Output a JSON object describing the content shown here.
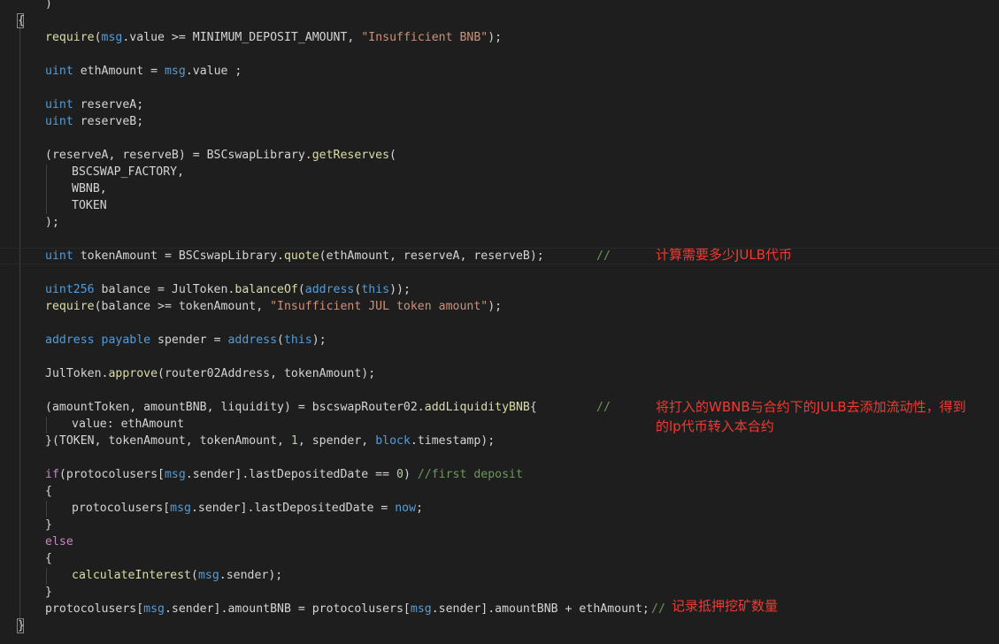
{
  "code": {
    "l01": ")",
    "l02": "{",
    "l03a": "require",
    "l03b": "(",
    "l03c": "msg",
    "l03d": ".value >= MINIMUM_DEPOSIT_AMOUNT, ",
    "l03e": "\"Insufficient BNB\"",
    "l03f": ");",
    "l04a": "uint",
    "l04b": " ethAmount = ",
    "l04c": "msg",
    "l04d": ".value ;",
    "l05a": "uint",
    "l05b": " reserveA;",
    "l06a": "uint",
    "l06b": " reserveB;",
    "l07a": "(reserveA, reserveB) = BSCswapLibrary.",
    "l07b": "getReserves",
    "l07c": "(",
    "l08": "BSCSWAP_FACTORY,",
    "l09": "WBNB,",
    "l10": "TOKEN",
    "l11": ");",
    "l12a": "uint",
    "l12b": " tokenAmount = BSCswapLibrary.",
    "l12c": "quote",
    "l12d": "(ethAmount, reserveA, reserveB);",
    "l12e": "//",
    "l13a": "uint256",
    "l13b": " balance = JulToken.",
    "l13c": "balanceOf",
    "l13d": "(",
    "l13e": "address",
    "l13f": "(",
    "l13g": "this",
    "l13h": "));",
    "l14a": "require",
    "l14b": "(balance >= tokenAmount, ",
    "l14c": "\"Insufficient JUL token amount\"",
    "l14d": ");",
    "l15a": "address",
    "l15b": " ",
    "l15c": "payable",
    "l15d": " spender = ",
    "l15e": "address",
    "l15f": "(",
    "l15g": "this",
    "l15h": ");",
    "l16a": "JulToken.",
    "l16b": "approve",
    "l16c": "(router02Address, tokenAmount);",
    "l17a": "(amountToken, amountBNB, liquidity) = bscswapRouter02.",
    "l17b": "addLiquidityBNB",
    "l17c": "{",
    "l17d": "//",
    "l18": "value: ethAmount",
    "l19a": "}(TOKEN, tokenAmount, tokenAmount, ",
    "l19b": "1",
    "l19c": ", spender, ",
    "l19d": "block",
    "l19e": ".timestamp);",
    "l20a": "if",
    "l20b": "(protocolusers[",
    "l20c": "msg",
    "l20d": ".sender].lastDepositedDate == ",
    "l20e": "0",
    "l20f": ") ",
    "l20g": "//first deposit",
    "l21": "{",
    "l22a": "protocolusers[",
    "l22b": "msg",
    "l22c": ".sender].lastDepositedDate = ",
    "l22d": "now",
    "l22e": ";",
    "l23": "}",
    "l24": "else",
    "l25": "{",
    "l26a": "calculateInterest",
    "l26b": "(",
    "l26c": "msg",
    "l26d": ".sender);",
    "l27": "}",
    "l28a": "protocolusers[",
    "l28b": "msg",
    "l28c": ".sender].amountBNB = protocolusers[",
    "l28d": "msg",
    "l28e": ".sender].amountBNB + ethAmount;",
    "l28f": "//",
    "l29": "}"
  },
  "annotations": {
    "token_amount": "计算需要多少JULB代币",
    "add_liquidity_1": "将打入的WBNB与合约下的JULB去添加流动性，得到",
    "add_liquidity_2": "的lp代币转入本合约",
    "record": "记录抵押挖矿数量"
  },
  "colors": {
    "background": "#1e1e1e",
    "keyword": "#569cd6",
    "control": "#c586c0",
    "function": "#dcdcaa",
    "string": "#ce9178",
    "number": "#b5cea8",
    "comment": "#6a9955",
    "annotation": "#f03a32"
  }
}
